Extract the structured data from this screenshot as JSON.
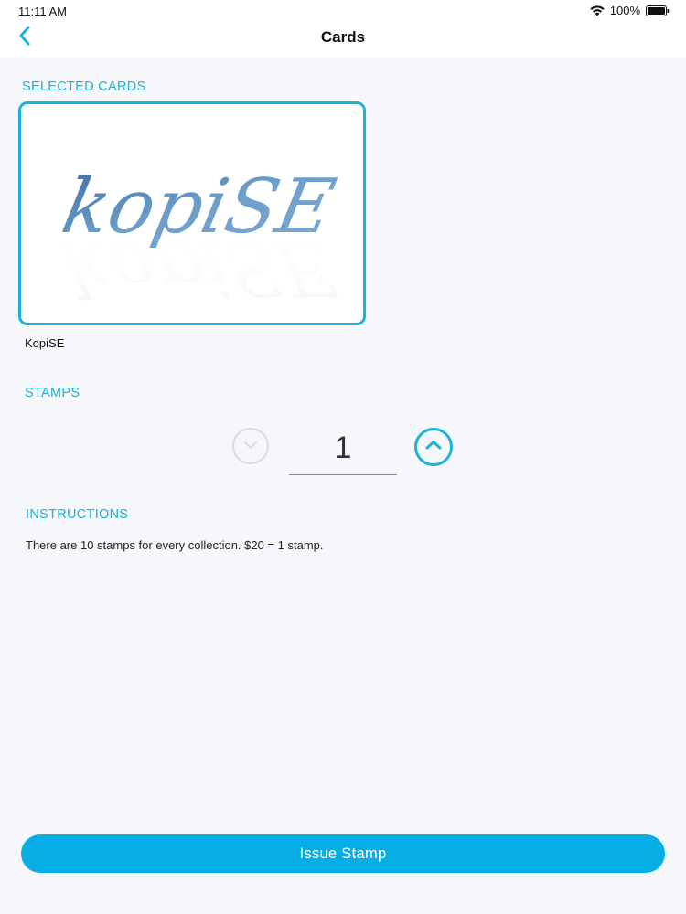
{
  "status_bar": {
    "time": "11:11 AM",
    "battery_percent": "100%"
  },
  "nav": {
    "title": "Cards",
    "back_icon": "chevron-left-icon"
  },
  "selected_cards": {
    "heading": "SELECTED CARDS",
    "card": {
      "logo_text": "kopiSE",
      "name": "KopiSE"
    }
  },
  "stamps": {
    "heading": "STAMPS",
    "value": "1",
    "decrement_icon": "chevron-down-icon",
    "increment_icon": "chevron-up-icon"
  },
  "instructions": {
    "heading": "INSTRUCTIONS",
    "text": "There are 10 stamps for every collection. $20 = 1 stamp."
  },
  "actions": {
    "issue_stamp_label": "Issue Stamp"
  },
  "colors": {
    "accent": "#1ab3d9",
    "button": "#07aee5",
    "background": "#f5f7fa"
  }
}
